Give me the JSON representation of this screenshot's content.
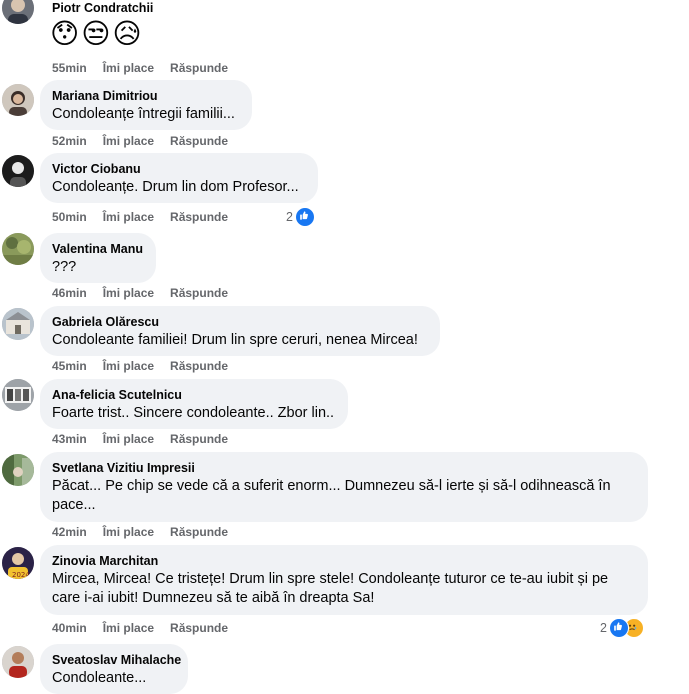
{
  "comments": [
    {
      "author": "Piotr Condratchii",
      "text": "😯😒😥",
      "time": "55min",
      "like": "Îmi place",
      "reply": "Răspunde"
    },
    {
      "author": "Mariana Dimitriou",
      "text": "Condoleanțe întregii familii...",
      "time": "52min",
      "like": "Îmi place",
      "reply": "Răspunde"
    },
    {
      "author": "Victor Ciobanu",
      "text": "Condoleanțe. Drum lin dom Profesor...",
      "time": "50min",
      "like": "Îmi place",
      "reply": "Răspunde",
      "reactions": {
        "count": "2",
        "icons": [
          "like-icon"
        ]
      }
    },
    {
      "author": "Valentina Manu",
      "text": "???",
      "time": "46min",
      "like": "Îmi place",
      "reply": "Răspunde"
    },
    {
      "author": "Gabriela Olărescu",
      "text": "Condoleante familiei! Drum lin spre ceruri, nenea Mircea!",
      "time": "45min",
      "like": "Îmi place",
      "reply": "Răspunde"
    },
    {
      "author": "Ana-felicia Scutelnicu",
      "text": "Foarte trist.. Sincere condoleante.. Zbor lin..",
      "time": "43min",
      "like": "Îmi place",
      "reply": "Răspunde"
    },
    {
      "author": "Svetlana Vizitiu Impresii",
      "text": "Păcat... Pe chip se vede că a suferit enorm... Dumnezeu să-l ierte și să-l odihnească în pace...",
      "time": "42min",
      "like": "Îmi place",
      "reply": "Răspunde"
    },
    {
      "author": "Zinovia Marchitan",
      "text": "Mircea, Mircea! Ce tristețe! Drum lin spre stele! Condoleanțe tuturor ce te-au iubit și pe care i-ai iubit! Dumnezeu să te aibă în dreapta Sa!",
      "time": "40min",
      "like": "Îmi place",
      "reply": "Răspunde",
      "reactions": {
        "count": "2",
        "icons": [
          "like-icon",
          "sad-icon"
        ]
      }
    },
    {
      "author": "Sveatoslav Mihalache",
      "text": "Condoleante..."
    }
  ],
  "colors": {
    "bubble": "#f0f2f5",
    "meta": "#65676b",
    "like_blue": "#1877f2",
    "sad_yellow": "#f7b125"
  }
}
